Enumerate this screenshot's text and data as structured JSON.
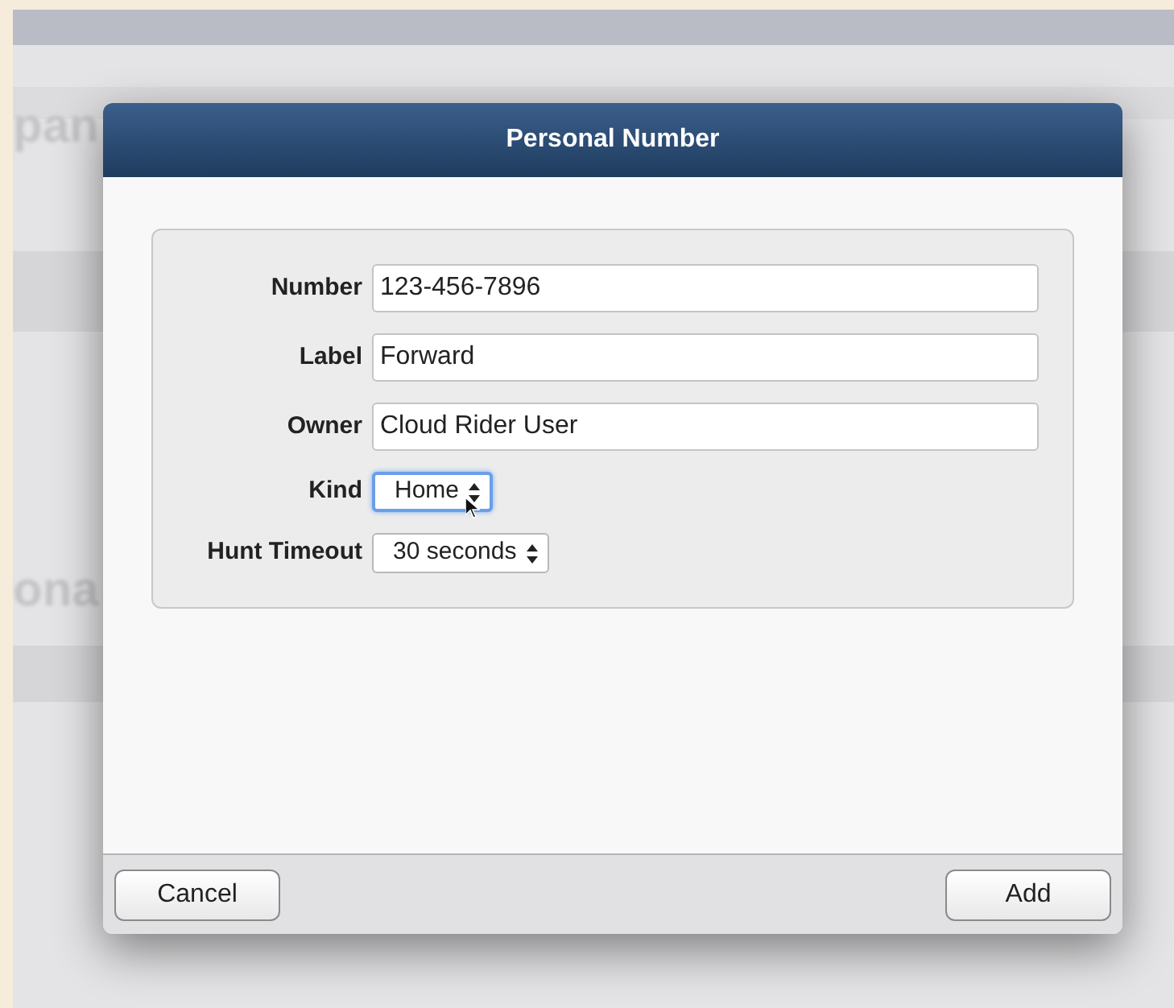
{
  "background": {
    "fragments": [
      "pan",
      "ona"
    ]
  },
  "dialog": {
    "title": "Personal Number",
    "fields": [
      {
        "kind": "text",
        "label": "Number",
        "value": "123-456-7896"
      },
      {
        "kind": "text",
        "label": "Label",
        "value": "Forward"
      },
      {
        "kind": "text",
        "label": "Owner",
        "value": "Cloud Rider User"
      },
      {
        "kind": "select",
        "label": "Kind",
        "value": "Home",
        "focused": true
      },
      {
        "kind": "select",
        "label": "Hunt Timeout",
        "value": "30 seconds",
        "focused": false
      }
    ],
    "buttons": [
      {
        "label": "Cancel"
      },
      {
        "label": "Add"
      }
    ]
  }
}
